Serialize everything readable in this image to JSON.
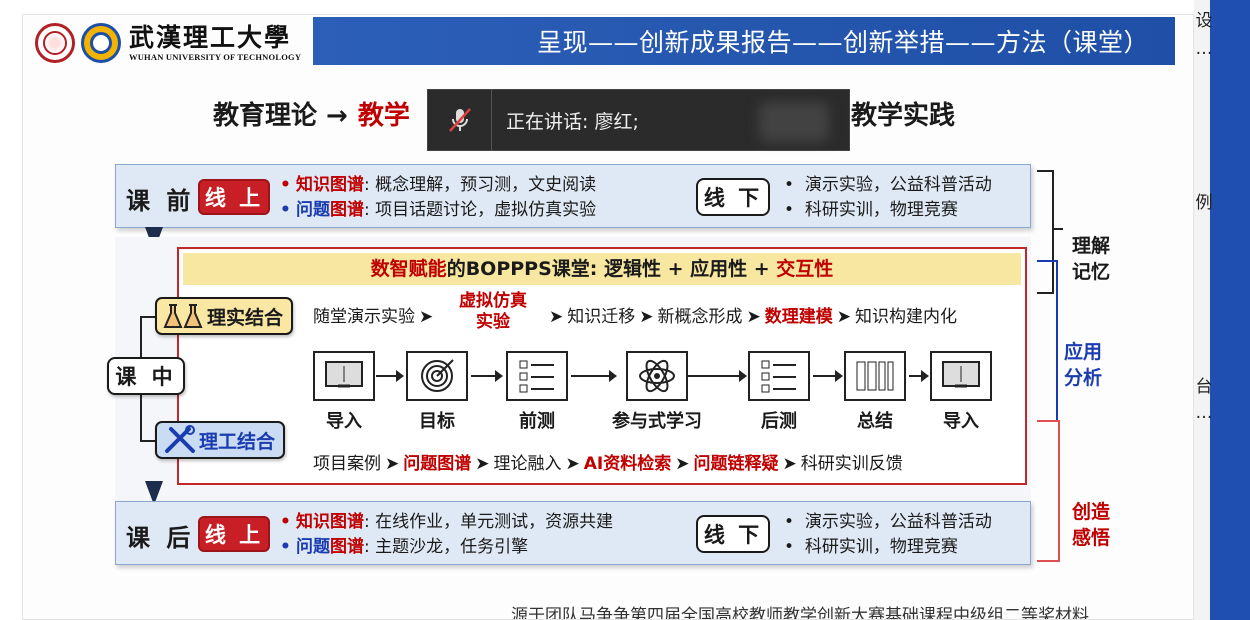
{
  "header": {
    "uni_cn": "武漢理工大學",
    "uni_en": "WUHAN UNIVERSITY OF TECHNOLOGY",
    "title": "呈现——创新成果报告——创新举措——方法（课堂）"
  },
  "theory": {
    "left": "教育理论 →",
    "mid": "教学",
    "right": "教学实践"
  },
  "speaking": {
    "text": "正在讲话:  廖红;"
  },
  "side": {
    "t1": "设",
    "t2": "…",
    "t3": "例",
    "t4": "台",
    "t5": "…"
  },
  "pre": {
    "label": "课 前",
    "online": "线 上",
    "row1_key_a": "知识",
    "row1_key_b": "图谱",
    "row1_text": ": 概念理解，预习测，文史阅读",
    "row2_key_a": "问题",
    "row2_key_b": "图谱",
    "row2_text": ": 项目话题讨论，虚拟仿真实验",
    "offline": "线 下",
    "off1": "演示实验，公益科普活动",
    "off2": "科研实训，物理竞赛"
  },
  "mid": {
    "bopp_a": "数智赋能",
    "bopp_b": "的BOPPPS课堂: 逻辑性 + 应用性 + ",
    "bopp_c": "交互性",
    "kezhong": "课 中",
    "lishi": "理实结合",
    "ligong": "理工结合",
    "top_flow": {
      "a": "随堂演示实验",
      "b1": "虚拟仿真",
      "b2": "实验",
      "c": "知识迁移",
      "d": "新概念形成",
      "e": "数理建模",
      "f": "知识构建内化"
    },
    "bottom_flow": {
      "a": "项目案例",
      "b": "问题图谱",
      "c": "理论融入",
      "d": "AI资料检索",
      "e": "问题链释疑",
      "f": "科研实训反馈"
    },
    "stages": [
      "导入",
      "目标",
      "前测",
      "参与式学习",
      "后测",
      "总结",
      "导入"
    ]
  },
  "post": {
    "label": "课 后",
    "online": "线 上",
    "row1_key_a": "知识",
    "row1_key_b": "图谱",
    "row1_text": ": 在线作业，单元测试，资源共建",
    "row2_key_a": "问题",
    "row2_key_b": "图谱",
    "row2_text": ": 主题沙龙，任务引擎",
    "offline": "线 下",
    "off1": "演示实验，公益科普活动",
    "off2": "科研实训，物理竞赛"
  },
  "brackets": {
    "understand1": "理解",
    "understand2": "记忆",
    "apply1": "应用",
    "apply2": "分析",
    "create1": "创造",
    "create2": "感悟"
  },
  "footer": {
    "source": "源于团队马争争第四届全国高校教师教学创新大赛基础课程中级组二等奖材料"
  },
  "colors": {
    "accent_blue": "#1f4fa6",
    "accent_red": "#c00000",
    "bopp_yellow": "#f7e7a0"
  }
}
